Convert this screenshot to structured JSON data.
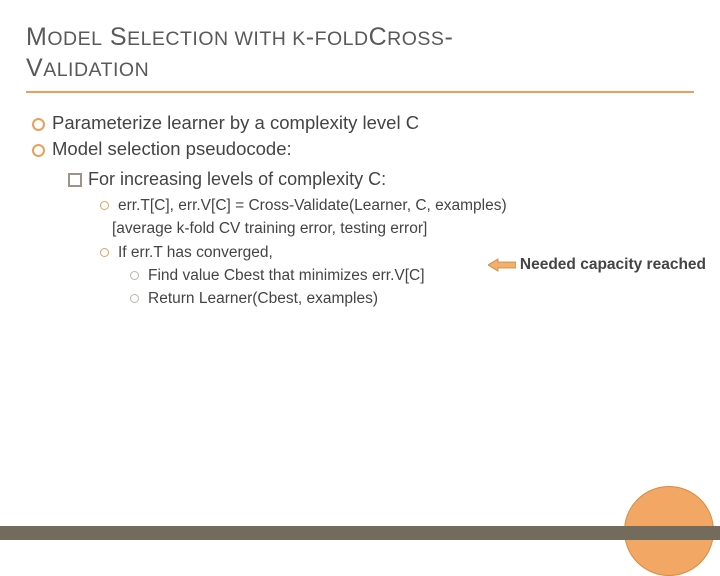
{
  "title_parts": {
    "p1a": "M",
    "p1b": "ODEL",
    "p2a": "S",
    "p2b": "ELECTION WITH K",
    "p3": "-",
    "p4a": "FOLD",
    "p4b": "C",
    "p4c": "ROSS",
    "p5": "-",
    "p6a": "V",
    "p6b": "ALIDATION"
  },
  "bullets": {
    "b1": "Parameterize learner by a complexity level C",
    "b2": "Model selection pseudocode:",
    "b2_1": "For increasing levels of complexity C:",
    "b2_1_1": "err.T[C], err.V[C] = Cross-Validate(Learner, C, examples)",
    "b2_1_1_sub": "[average k-fold CV training error, testing error]",
    "b2_1_2": "If err.T has converged,",
    "b2_1_2_1": "Find value Cbest that minimizes err.V[C]",
    "b2_1_2_2": "Return Learner(Cbest, examples)"
  },
  "callout": "Needed capacity reached"
}
